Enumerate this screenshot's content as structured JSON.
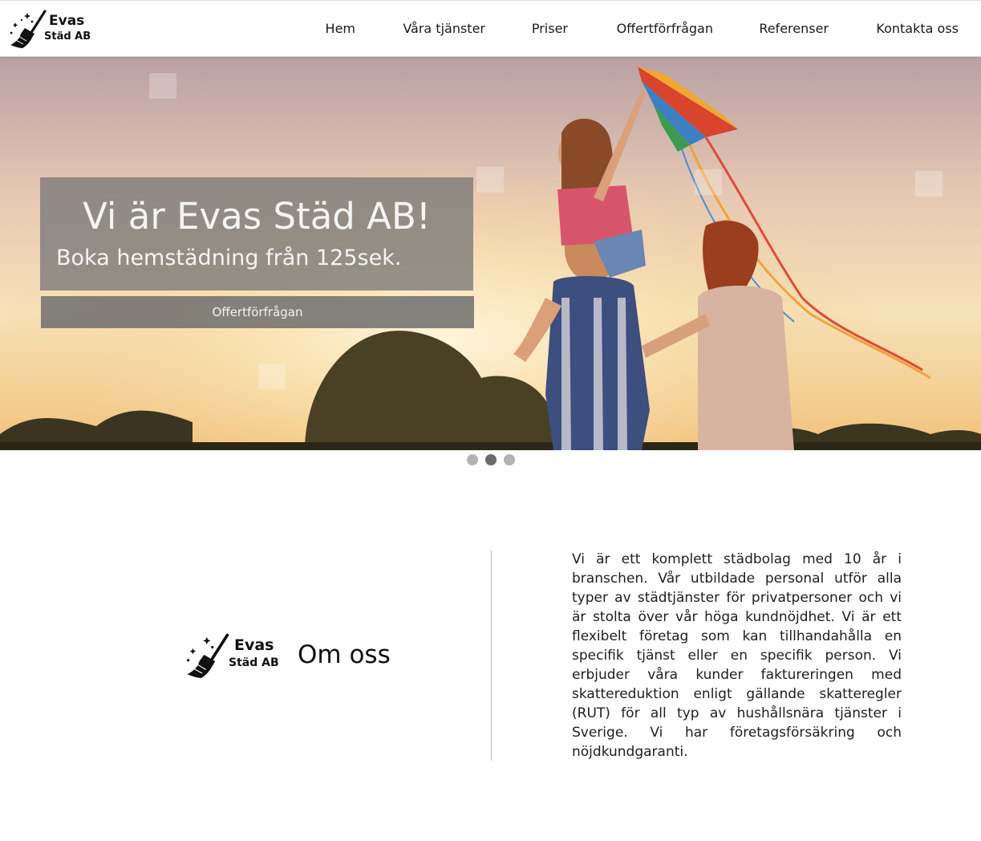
{
  "header": {
    "logo": {
      "name": "Evas",
      "sub": "Städ AB"
    },
    "nav": [
      {
        "label": "Hem"
      },
      {
        "label": "Våra tjänster"
      },
      {
        "label": "Priser"
      },
      {
        "label": "Offertförfrågan"
      },
      {
        "label": "Referenser"
      },
      {
        "label": "Kontakta oss"
      }
    ]
  },
  "hero": {
    "title": "Vi är Evas Städ AB!",
    "subtitle": "Boka hemstädning från 125sek.",
    "cta_label": "Offertförfrågan",
    "slides_total": 3,
    "active_slide": 2
  },
  "about": {
    "logo": {
      "name": "Evas",
      "sub": "Städ AB"
    },
    "title": "Om oss",
    "text": "Vi är ett komplett städbolag med 10 år i branschen. Vår utbildade personal utför alla typer av städtjänster för privatpersoner och vi är stolta över vår höga kundnöjdhet. Vi är ett flexibelt företag som kan tillhandahålla en specifik tjänst eller en specifik person. Vi erbjuder våra kunder faktureringen med skattereduktion enligt gällande skatteregler (RUT) för all typ av hushållsnära tjänster i Sverige. Vi har företagsförsäkring och nöjdkundgaranti."
  },
  "colors": {
    "hero_overlay": "#787878",
    "dot_active": "#6a6a6a",
    "dot_inactive": "#b3b3b3"
  }
}
